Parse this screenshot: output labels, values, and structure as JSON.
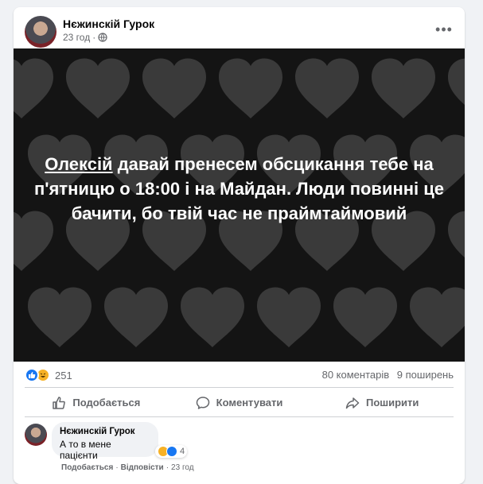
{
  "post": {
    "author": "Нєжинскій Гурок",
    "time": "23 год",
    "privacy_icon": "globe-icon",
    "more_icon": "more-options-icon",
    "more_label": "•••"
  },
  "image": {
    "background": "#141414",
    "heart_color": "#3a3a3a",
    "caption_mention": "Олексій",
    "caption_rest": " давай пренесем обсцикання тебе на п'ятницю о 18:00 і на Майдан. Люди повинні це бачити, бо твій час не праймтаймовий"
  },
  "stats": {
    "reaction_icons": [
      "like-icon",
      "haha-icon"
    ],
    "reaction_count": "251",
    "comments": "80 коментарів",
    "shares": "9 поширень"
  },
  "actions": {
    "like": "Подобається",
    "comment": "Коментувати",
    "share": "Поширити"
  },
  "comment": {
    "author": "Нєжинскій Гурок",
    "text": "А то в мене пацієнти",
    "reaction_count": "4",
    "like": "Подобається",
    "separator": "·",
    "reply": "Відповісти",
    "time": "23 год"
  },
  "colors": {
    "accent": "#1877f2",
    "haha": "#f7b125",
    "secondary_text": "#65676b"
  }
}
